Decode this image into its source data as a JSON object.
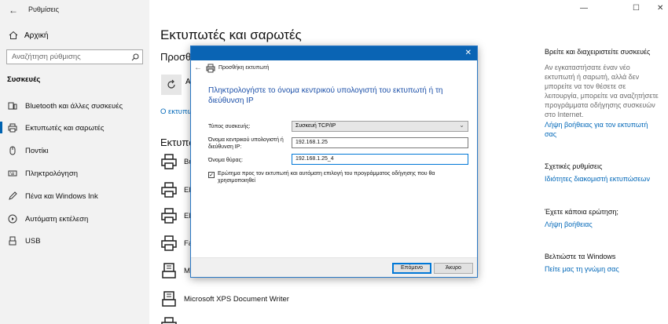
{
  "window": {
    "title": "Ρυθμίσεις",
    "controls": [
      "—",
      "☐",
      "✕"
    ]
  },
  "sidebar": {
    "home_label": "Αρχική",
    "search_placeholder": "Αναζήτηση ρύθμισης",
    "section_label": "Συσκευές",
    "items": [
      {
        "label": "Bluetooth και άλλες συσκευές",
        "icon": "bluetooth-icon"
      },
      {
        "label": "Εκτυπωτές και σαρωτές",
        "icon": "printer-icon",
        "active": true
      },
      {
        "label": "Ποντίκι",
        "icon": "mouse-icon"
      },
      {
        "label": "Πληκτρολόγηση",
        "icon": "keyboard-icon"
      },
      {
        "label": "Πένα και Windows Ink",
        "icon": "pen-icon"
      },
      {
        "label": "Αυτόματη εκτέλεση",
        "icon": "autoplay-icon"
      },
      {
        "label": "USB",
        "icon": "usb-icon"
      }
    ]
  },
  "main": {
    "title": "Εκτυπωτές και σαρωτές",
    "add_section_partial": "Προσθ",
    "refresh_label_partial": "Α",
    "link_partial": "Ο εκτυπω",
    "printers_heading_partial": "Εκτυπω",
    "printers": [
      {
        "name": "Bu",
        "icon": "printer-icon"
      },
      {
        "name": "EP",
        "icon": "printer-icon"
      },
      {
        "name": "EP",
        "icon": "printer-icon"
      },
      {
        "name": "Fa",
        "icon": "printer-icon"
      },
      {
        "name": "M",
        "icon": "document-printer-icon"
      },
      {
        "name": "Microsoft XPS Document Writer",
        "icon": "document-printer-icon"
      }
    ]
  },
  "right": {
    "find_heading": "Βρείτε και διαχειριστείτε συσκευές",
    "find_text": "Αν εγκαταστήσατε έναν νέο εκτυπωτή ή σαρωτή, αλλά δεν μπορείτε να τον θέσετε σε λειτουργία, μπορείτε να αναζητήσετε προγράμματα οδήγησης συσκευών στο Internet.",
    "find_link": "Λήψη βοήθειας για τον εκτυπωτή σας",
    "related_heading": "Σχετικές ρυθμίσεις",
    "related_link": "Ιδιότητες διακομιστή εκτυπώσεων",
    "question_heading": "Έχετε κάποια ερώτηση;",
    "question_link": "Λήψη βοήθειας",
    "improve_heading": "Βελτιώστε τα Windows",
    "improve_link": "Πείτε μας τη γνώμη σας"
  },
  "dialog": {
    "caption": "Προσθήκη εκτυπωτή",
    "heading": "Πληκτρολογήστε το όνομα κεντρικού υπολογιστή του εκτυπωτή ή τη διεύθυνση IP",
    "device_type_label": "Τύπος συσκευής:",
    "device_type_value": "Συσκευή TCP/IP",
    "host_label": "Όνομα κεντρικού υπολογιστή ή διεύθυνση IP:",
    "host_value": "192.168.1.25",
    "port_label": "Όνομα θύρας:",
    "port_value": "192.168.1.25_4",
    "checkbox_label": "Ερώτημα προς τον εκτυπωτή και αυτόματη επιλογή του προγράμματος οδήγησης που θα χρησιμοποιηθεί",
    "checkbox_checked": true,
    "next_button": "Επόμενο",
    "cancel_button": "Άκυρο"
  }
}
